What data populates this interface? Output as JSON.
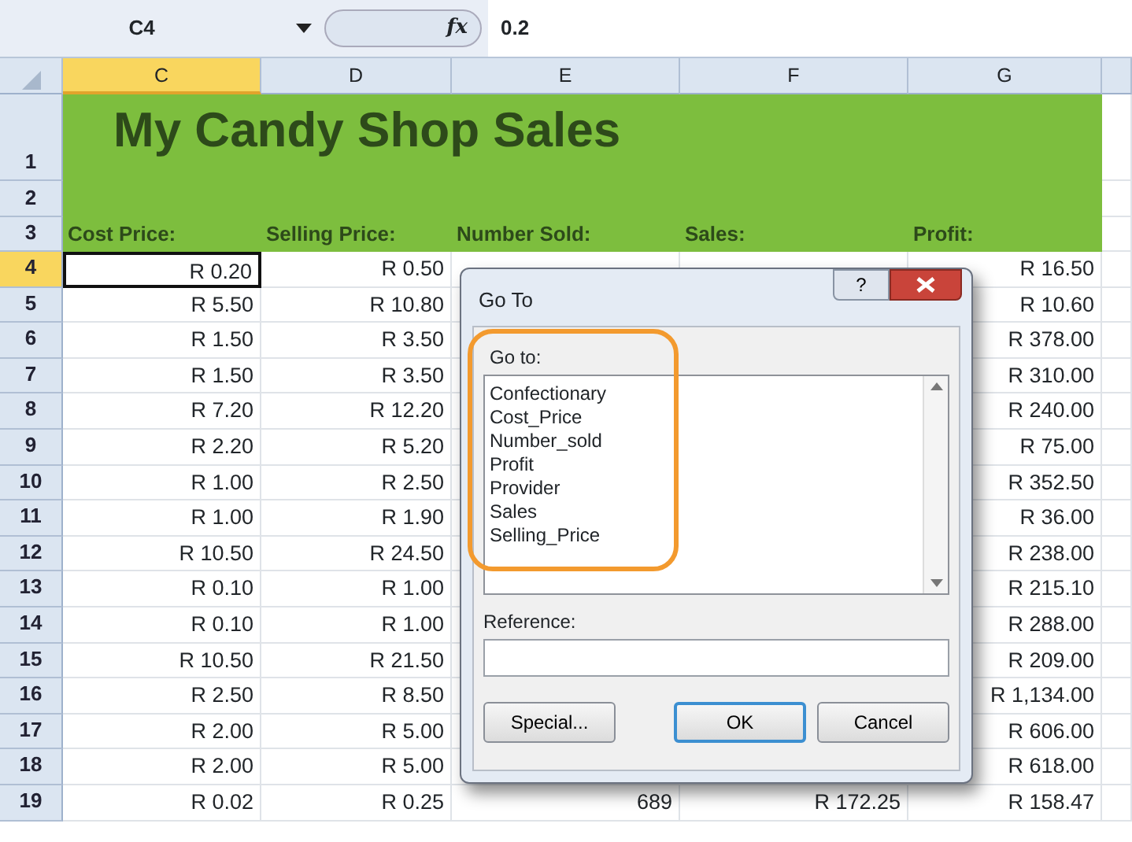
{
  "formula_bar": {
    "name_box": "C4",
    "fx": "fx",
    "formula": "0.2"
  },
  "columns": [
    {
      "label": "C",
      "selected": true
    },
    {
      "label": "D",
      "selected": false
    },
    {
      "label": "E",
      "selected": false
    },
    {
      "label": "F",
      "selected": false
    },
    {
      "label": "G",
      "selected": false
    }
  ],
  "title_rows": [
    {
      "number": "1",
      "selected": false
    },
    {
      "number": "2",
      "selected": false
    },
    {
      "number": "3",
      "selected": false
    }
  ],
  "title": "My Candy Shop Sales",
  "headings": [
    "Cost Price:",
    "Selling Price:",
    "Number Sold:",
    "Sales:",
    "Profit:"
  ],
  "rows": [
    {
      "number": "4",
      "selected": true,
      "cells": [
        "R 0.20",
        "R 0.50",
        null,
        null,
        "R 16.50"
      ]
    },
    {
      "number": "5",
      "selected": false,
      "cells": [
        "R 5.50",
        "R 10.80",
        null,
        null,
        "R 10.60"
      ]
    },
    {
      "number": "6",
      "selected": false,
      "cells": [
        "R 1.50",
        "R 3.50",
        null,
        null,
        "R 378.00"
      ]
    },
    {
      "number": "7",
      "selected": false,
      "cells": [
        "R 1.50",
        "R 3.50",
        null,
        null,
        "R 310.00"
      ]
    },
    {
      "number": "8",
      "selected": false,
      "cells": [
        "R 7.20",
        "R 12.20",
        null,
        null,
        "R 240.00"
      ]
    },
    {
      "number": "9",
      "selected": false,
      "cells": [
        "R 2.20",
        "R 5.20",
        null,
        null,
        "R 75.00"
      ]
    },
    {
      "number": "10",
      "selected": false,
      "cells": [
        "R 1.00",
        "R 2.50",
        null,
        null,
        "R 352.50"
      ]
    },
    {
      "number": "11",
      "selected": false,
      "cells": [
        "R 1.00",
        "R 1.90",
        null,
        null,
        "R 36.00"
      ]
    },
    {
      "number": "12",
      "selected": false,
      "cells": [
        "R 10.50",
        "R 24.50",
        null,
        null,
        "R 238.00"
      ]
    },
    {
      "number": "13",
      "selected": false,
      "cells": [
        "R 0.10",
        "R 1.00",
        null,
        null,
        "R 215.10"
      ]
    },
    {
      "number": "14",
      "selected": false,
      "cells": [
        "R 0.10",
        "R 1.00",
        null,
        null,
        "R 288.00"
      ]
    },
    {
      "number": "15",
      "selected": false,
      "cells": [
        "R 10.50",
        "R 21.50",
        null,
        null,
        "R 209.00"
      ]
    },
    {
      "number": "16",
      "selected": false,
      "cells": [
        "R 2.50",
        "R 8.50",
        null,
        null,
        "R 1,134.00"
      ]
    },
    {
      "number": "17",
      "selected": false,
      "cells": [
        "R 2.00",
        "R 5.00",
        null,
        null,
        "R 606.00"
      ]
    },
    {
      "number": "18",
      "selected": false,
      "cells": [
        "R 2.00",
        "R 5.00",
        null,
        null,
        "R 618.00"
      ]
    },
    {
      "number": "19",
      "selected": false,
      "cells": [
        "R 0.02",
        "R 0.25",
        "689",
        "R 172.25",
        "R 158.47"
      ]
    }
  ],
  "dialog": {
    "title": "Go To",
    "help": "?",
    "list_label": "Go to:",
    "items": [
      "Confectionary",
      "Cost_Price",
      "Number_sold",
      "Profit",
      "Provider",
      "Sales",
      "Selling_Price"
    ],
    "reference_label": "Reference:",
    "buttons": [
      {
        "label": "Special...",
        "default": false
      },
      {
        "label": "OK",
        "default": true
      },
      {
        "label": "Cancel",
        "default": false
      }
    ]
  }
}
